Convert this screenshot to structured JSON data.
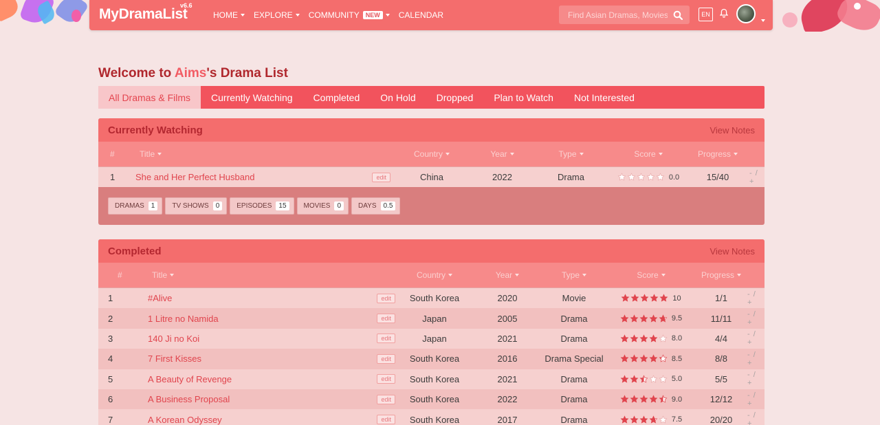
{
  "nav": {
    "logo": "MyDramaList",
    "version": "v6.6",
    "items": [
      {
        "label": "HOME",
        "has_caret": true
      },
      {
        "label": "EXPLORE",
        "has_caret": true
      },
      {
        "label": "COMMUNITY",
        "has_caret": true,
        "badge": "NEW"
      },
      {
        "label": "CALENDAR",
        "has_caret": false
      }
    ],
    "search_placeholder": "Find Asian Dramas, Movies",
    "lang": "EN"
  },
  "page": {
    "title_prefix": "Welcome to ",
    "username": "Aims",
    "title_suffix": "'s Drama List"
  },
  "tabs": [
    {
      "label": "All Dramas & Films",
      "active": true
    },
    {
      "label": "Currently Watching",
      "active": false
    },
    {
      "label": "Completed",
      "active": false
    },
    {
      "label": "On Hold",
      "active": false
    },
    {
      "label": "Dropped",
      "active": false
    },
    {
      "label": "Plan to Watch",
      "active": false
    },
    {
      "label": "Not Interested",
      "active": false
    }
  ],
  "columns": {
    "num": "#",
    "title": "Title",
    "country": "Country",
    "year": "Year",
    "type": "Type",
    "score": "Score",
    "progress": "Progress"
  },
  "edit_label": "edit",
  "pm_label": "- / +",
  "view_notes": "View Notes",
  "currently_watching": {
    "title": "Currently Watching",
    "rows": [
      {
        "num": "1",
        "title": "She and Her Perfect Husband",
        "country": "China",
        "year": "2022",
        "type": "Drama",
        "score": "0.0",
        "rating": 0,
        "progress": "15/40"
      }
    ],
    "stats": [
      {
        "label": "DRAMAS",
        "value": "1"
      },
      {
        "label": "TV SHOWS",
        "value": "0"
      },
      {
        "label": "EPISODES",
        "value": "15"
      },
      {
        "label": "MOVIES",
        "value": "0"
      },
      {
        "label": "DAYS",
        "value": "0.5"
      }
    ]
  },
  "completed": {
    "title": "Completed",
    "rows": [
      {
        "num": "1",
        "title": "#Alive",
        "country": "South Korea",
        "year": "2020",
        "type": "Movie",
        "score": "10",
        "rating": 10,
        "progress": "1/1"
      },
      {
        "num": "2",
        "title": "1 Litre no Namida",
        "country": "Japan",
        "year": "2005",
        "type": "Drama",
        "score": "9.5",
        "rating": 9.5,
        "progress": "11/11"
      },
      {
        "num": "3",
        "title": "140 Ji no Koi",
        "country": "Japan",
        "year": "2021",
        "type": "Drama",
        "score": "8.0",
        "rating": 8.0,
        "progress": "4/4"
      },
      {
        "num": "4",
        "title": "7 First Kisses",
        "country": "South Korea",
        "year": "2016",
        "type": "Drama Special",
        "score": "8.5",
        "rating": 8.5,
        "progress": "8/8"
      },
      {
        "num": "5",
        "title": "A Beauty of Revenge",
        "country": "South Korea",
        "year": "2021",
        "type": "Drama",
        "score": "5.0",
        "rating": 5.0,
        "progress": "5/5"
      },
      {
        "num": "6",
        "title": "A Business Proposal",
        "country": "South Korea",
        "year": "2022",
        "type": "Drama",
        "score": "9.0",
        "rating": 9.0,
        "progress": "12/12"
      },
      {
        "num": "7",
        "title": "A Korean Odyssey",
        "country": "South Korea",
        "year": "2017",
        "type": "Drama",
        "score": "7.5",
        "rating": 7.5,
        "progress": "20/20"
      }
    ]
  },
  "colors": {
    "nav_bg": "#f46d6d",
    "tabs_bg": "#f2535d",
    "accent_text": "#e0444d",
    "star_filled": "#e0444d",
    "star_empty": "#ffffff"
  }
}
